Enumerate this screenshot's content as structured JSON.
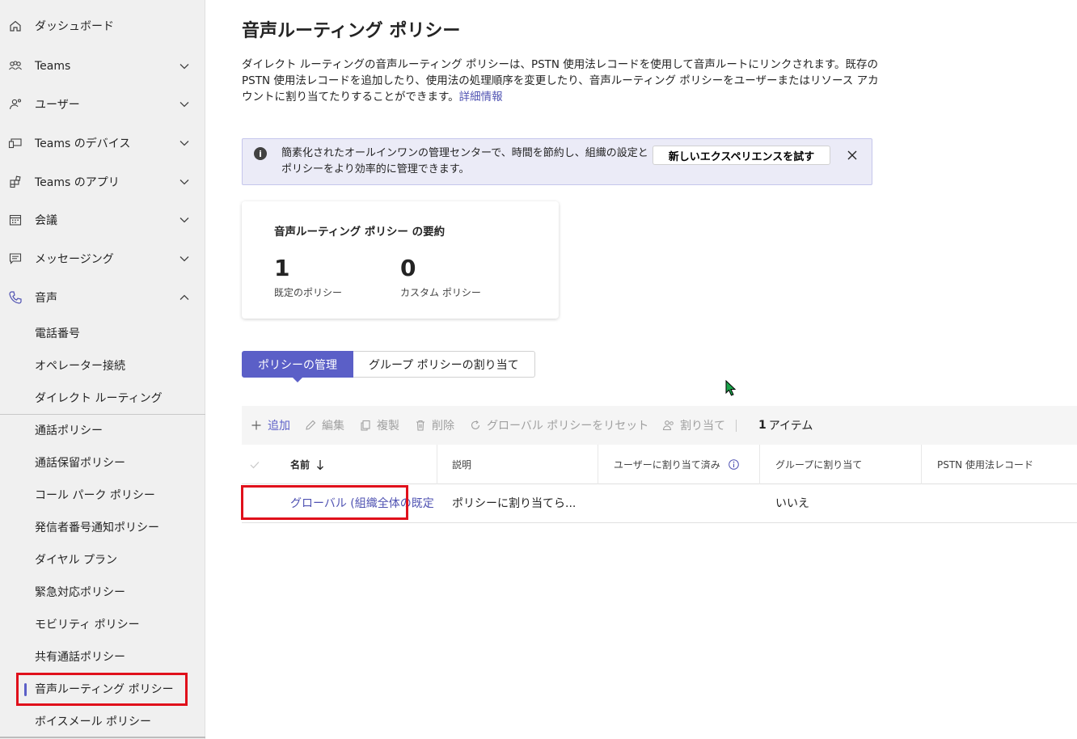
{
  "sidebar": {
    "items": [
      {
        "label": "ダッシュボード",
        "icon": "home-icon"
      },
      {
        "label": "Teams",
        "icon": "teams-icon"
      },
      {
        "label": "ユーザー",
        "icon": "users-icon"
      },
      {
        "label": "Teams のデバイス",
        "icon": "devices-icon"
      },
      {
        "label": "Teams のアプリ",
        "icon": "apps-icon"
      },
      {
        "label": "会議",
        "icon": "calendar-icon"
      },
      {
        "label": "メッセージング",
        "icon": "chat-icon"
      },
      {
        "label": "音声",
        "icon": "phone-icon"
      }
    ],
    "voice_subitems": [
      "電話番号",
      "オペレーター接続",
      "ダイレクト ルーティング",
      "通話ポリシー",
      "通話保留ポリシー",
      "コール パーク ポリシー",
      "発信者番号通知ポリシー",
      "ダイヤル プラン",
      "緊急対応ポリシー",
      "モビリティ ポリシー",
      "共有通話ポリシー",
      "音声ルーティング ポリシー",
      "ボイスメール ポリシー"
    ],
    "active_item": "音声ルーティング ポリシー"
  },
  "page": {
    "title": "音声ルーティング ポリシー",
    "description": "ダイレクト ルーティングの音声ルーティング ポリシーは、PSTN 使用法レコードを使用して音声ルートにリンクされます。既存の PSTN 使用法レコードを追加したり、使用法の処理順序を変更したり、音声ルーティング ポリシーをユーザーまたはリソース アカウントに割り当てたりすることができます。",
    "learn_more": "詳細情報"
  },
  "banner": {
    "text": "簡素化されたオールインワンの管理センターで、時間を節約し、組織の設定とポリシーをより効率的に管理できます。",
    "button": "新しいエクスペリエンスを試す"
  },
  "summary": {
    "title": "音声ルーティング ポリシー の要約",
    "default_count": "1",
    "default_label": "既定のポリシー",
    "custom_count": "0",
    "custom_label": "カスタム ポリシー"
  },
  "tabs": {
    "manage": "ポリシーの管理",
    "group": "グループ ポリシーの割り当て"
  },
  "toolbar": {
    "add": "追加",
    "edit": "編集",
    "copy": "複製",
    "delete": "削除",
    "reset": "グローバル ポリシーをリセット",
    "assign": "割り当て",
    "count": "1",
    "count_unit": "アイテム"
  },
  "table": {
    "headers": {
      "name": "名前",
      "description": "説明",
      "assigned_users": "ユーザーに割り当て済み",
      "group_assign": "グループに割り当て",
      "pstn": "PSTN 使用法レコード"
    },
    "rows": [
      {
        "name": "グローバル (組織全体の既定値)",
        "description": "ポリシーに割り当てら...",
        "assigned_users": "",
        "group_assign": "いいえ",
        "pstn": ""
      }
    ]
  },
  "colors": {
    "accent": "#5b5fc7",
    "link": "#4f52b2",
    "highlight": "#e0101b",
    "banner_bg": "#ebebf7"
  }
}
